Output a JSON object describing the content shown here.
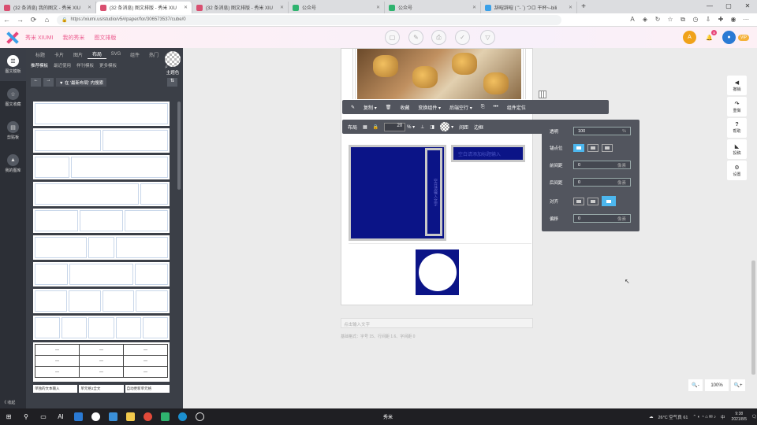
{
  "browser": {
    "tabs": [
      {
        "title": "(32 条消息) 我的图文 - 秀米 XIU",
        "color": "#d94f70",
        "active": false
      },
      {
        "title": "(32 条消息) 图文排版 - 秀米 XIU",
        "color": "#d94f70",
        "active": true
      },
      {
        "title": "(32 条消息) 图文排版 - 秀米 XIU",
        "color": "#d94f70",
        "active": false
      },
      {
        "title": "公众号",
        "color": "#2fb36f",
        "active": false
      },
      {
        "title": "公众号",
        "color": "#2fb36f",
        "active": false
      },
      {
        "title": "辞暄辞暄 ( \"- `) つロ 干杯~-bili",
        "color": "#3aa0e8",
        "active": false
      }
    ],
    "new_tab": "+",
    "url": "https://xiumi.us/studio/v5#/paper/for/306573537/cube/0",
    "nav": {
      "back": "←",
      "forward": "→",
      "reload": "⟳",
      "home": "⌂"
    }
  },
  "app": {
    "brand": "秀米 XIUMI",
    "links": [
      "我的秀米",
      "图文排版"
    ],
    "header_tools": [
      "▢",
      "✎",
      "⎙",
      "✓",
      "▽"
    ],
    "avatar_letter": "A",
    "notif_count": "3",
    "vip": "VIP"
  },
  "leftnav": {
    "items": [
      {
        "label": "图文模板",
        "icon": "☰"
      },
      {
        "label": "图文收藏",
        "icon": "☆"
      },
      {
        "label": "剪贴板",
        "icon": "▤"
      },
      {
        "label": "我的图库",
        "icon": "▲"
      }
    ],
    "collapse": "《 收起"
  },
  "panel": {
    "tabs": [
      "标题",
      "卡片",
      "图片",
      "布局",
      "SVG",
      "组件",
      "热门"
    ],
    "active_tab": 3,
    "subtabs": [
      "推荐模板",
      "最近使用",
      "样刊模板",
      "更多模板"
    ],
    "active_subtab": 0,
    "search_icon": "⌕",
    "plain_color": "主题色",
    "filter": "▼ 在 '最新布局' 内搜索",
    "prev": "←",
    "next": "→",
    "sort": "⇅",
    "table_cell": "—",
    "bottom_labels": [
      "单独的文本输入",
      "单元格1全文",
      "自动更新单元格"
    ]
  },
  "toolbar1": {
    "items": [
      "✎",
      "复制 ▾",
      "🗑",
      "收藏",
      "变换组件 ▾",
      "后端空行 ▾",
      "⎘",
      "•••",
      "组件定位"
    ]
  },
  "toolbar2": {
    "layout": "布局",
    "margin_label": "▦",
    "margin_value": "20",
    "unit": "% ▾",
    "spacing": "间距",
    "border": "边框",
    "icon_a": "⊥",
    "icon_b": "◨"
  },
  "content": {
    "vertical_text": "空日请输入文字",
    "title_placeholder": "空白请添加标题输入",
    "caption_placeholder": "点击输入文字",
    "format_note": "基础格式：字号 15、行间距 1.6、字间距 0"
  },
  "props": {
    "opacity_label": "透明",
    "opacity_value": "100",
    "opacity_unit": "%",
    "anchor_label": "锚点位",
    "margin_top_label": "前间距",
    "margin_top_value": "0",
    "margin_top_unit": "像素",
    "margin_bottom_label": "后间距",
    "margin_bottom_value": "0",
    "margin_bottom_unit": "像素",
    "align_label": "对齐",
    "offset_label": "偏移",
    "offset_value": "0",
    "offset_unit": "像素"
  },
  "right_side": [
    {
      "icon": "◀",
      "label": "撤销"
    },
    {
      "icon": "↷",
      "label": "重做"
    },
    {
      "icon": "?",
      "label": "帮助"
    },
    {
      "icon": "◣",
      "label": "投稿"
    },
    {
      "icon": "⚙",
      "label": "设置"
    }
  ],
  "zoom": {
    "out": "🔍-",
    "value": "100%",
    "in": "🔍+"
  },
  "taskbar": {
    "temp": "26°C 空气良 61",
    "ime": "中",
    "time": "9:38",
    "date": "2021/8/5",
    "app_label": "秀米",
    "start": "⊞",
    "search": "⚲",
    "taskview": "▭",
    "ai": "AI"
  }
}
